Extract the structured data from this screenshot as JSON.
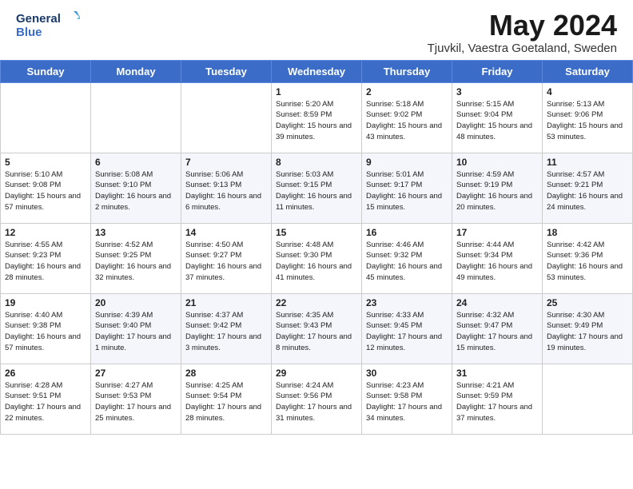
{
  "header": {
    "logo_line1": "General",
    "logo_line2": "Blue",
    "month_year": "May 2024",
    "location": "Tjuvkil, Vaestra Goetaland, Sweden"
  },
  "weekdays": [
    "Sunday",
    "Monday",
    "Tuesday",
    "Wednesday",
    "Thursday",
    "Friday",
    "Saturday"
  ],
  "weeks": [
    [
      {
        "day": "",
        "sunrise": "",
        "sunset": "",
        "daylight": ""
      },
      {
        "day": "",
        "sunrise": "",
        "sunset": "",
        "daylight": ""
      },
      {
        "day": "",
        "sunrise": "",
        "sunset": "",
        "daylight": ""
      },
      {
        "day": "1",
        "sunrise": "Sunrise: 5:20 AM",
        "sunset": "Sunset: 8:59 PM",
        "daylight": "Daylight: 15 hours and 39 minutes."
      },
      {
        "day": "2",
        "sunrise": "Sunrise: 5:18 AM",
        "sunset": "Sunset: 9:02 PM",
        "daylight": "Daylight: 15 hours and 43 minutes."
      },
      {
        "day": "3",
        "sunrise": "Sunrise: 5:15 AM",
        "sunset": "Sunset: 9:04 PM",
        "daylight": "Daylight: 15 hours and 48 minutes."
      },
      {
        "day": "4",
        "sunrise": "Sunrise: 5:13 AM",
        "sunset": "Sunset: 9:06 PM",
        "daylight": "Daylight: 15 hours and 53 minutes."
      }
    ],
    [
      {
        "day": "5",
        "sunrise": "Sunrise: 5:10 AM",
        "sunset": "Sunset: 9:08 PM",
        "daylight": "Daylight: 15 hours and 57 minutes."
      },
      {
        "day": "6",
        "sunrise": "Sunrise: 5:08 AM",
        "sunset": "Sunset: 9:10 PM",
        "daylight": "Daylight: 16 hours and 2 minutes."
      },
      {
        "day": "7",
        "sunrise": "Sunrise: 5:06 AM",
        "sunset": "Sunset: 9:13 PM",
        "daylight": "Daylight: 16 hours and 6 minutes."
      },
      {
        "day": "8",
        "sunrise": "Sunrise: 5:03 AM",
        "sunset": "Sunset: 9:15 PM",
        "daylight": "Daylight: 16 hours and 11 minutes."
      },
      {
        "day": "9",
        "sunrise": "Sunrise: 5:01 AM",
        "sunset": "Sunset: 9:17 PM",
        "daylight": "Daylight: 16 hours and 15 minutes."
      },
      {
        "day": "10",
        "sunrise": "Sunrise: 4:59 AM",
        "sunset": "Sunset: 9:19 PM",
        "daylight": "Daylight: 16 hours and 20 minutes."
      },
      {
        "day": "11",
        "sunrise": "Sunrise: 4:57 AM",
        "sunset": "Sunset: 9:21 PM",
        "daylight": "Daylight: 16 hours and 24 minutes."
      }
    ],
    [
      {
        "day": "12",
        "sunrise": "Sunrise: 4:55 AM",
        "sunset": "Sunset: 9:23 PM",
        "daylight": "Daylight: 16 hours and 28 minutes."
      },
      {
        "day": "13",
        "sunrise": "Sunrise: 4:52 AM",
        "sunset": "Sunset: 9:25 PM",
        "daylight": "Daylight: 16 hours and 32 minutes."
      },
      {
        "day": "14",
        "sunrise": "Sunrise: 4:50 AM",
        "sunset": "Sunset: 9:27 PM",
        "daylight": "Daylight: 16 hours and 37 minutes."
      },
      {
        "day": "15",
        "sunrise": "Sunrise: 4:48 AM",
        "sunset": "Sunset: 9:30 PM",
        "daylight": "Daylight: 16 hours and 41 minutes."
      },
      {
        "day": "16",
        "sunrise": "Sunrise: 4:46 AM",
        "sunset": "Sunset: 9:32 PM",
        "daylight": "Daylight: 16 hours and 45 minutes."
      },
      {
        "day": "17",
        "sunrise": "Sunrise: 4:44 AM",
        "sunset": "Sunset: 9:34 PM",
        "daylight": "Daylight: 16 hours and 49 minutes."
      },
      {
        "day": "18",
        "sunrise": "Sunrise: 4:42 AM",
        "sunset": "Sunset: 9:36 PM",
        "daylight": "Daylight: 16 hours and 53 minutes."
      }
    ],
    [
      {
        "day": "19",
        "sunrise": "Sunrise: 4:40 AM",
        "sunset": "Sunset: 9:38 PM",
        "daylight": "Daylight: 16 hours and 57 minutes."
      },
      {
        "day": "20",
        "sunrise": "Sunrise: 4:39 AM",
        "sunset": "Sunset: 9:40 PM",
        "daylight": "Daylight: 17 hours and 1 minute."
      },
      {
        "day": "21",
        "sunrise": "Sunrise: 4:37 AM",
        "sunset": "Sunset: 9:42 PM",
        "daylight": "Daylight: 17 hours and 3 minutes."
      },
      {
        "day": "22",
        "sunrise": "Sunrise: 4:35 AM",
        "sunset": "Sunset: 9:43 PM",
        "daylight": "Daylight: 17 hours and 8 minutes."
      },
      {
        "day": "23",
        "sunrise": "Sunrise: 4:33 AM",
        "sunset": "Sunset: 9:45 PM",
        "daylight": "Daylight: 17 hours and 12 minutes."
      },
      {
        "day": "24",
        "sunrise": "Sunrise: 4:32 AM",
        "sunset": "Sunset: 9:47 PM",
        "daylight": "Daylight: 17 hours and 15 minutes."
      },
      {
        "day": "25",
        "sunrise": "Sunrise: 4:30 AM",
        "sunset": "Sunset: 9:49 PM",
        "daylight": "Daylight: 17 hours and 19 minutes."
      }
    ],
    [
      {
        "day": "26",
        "sunrise": "Sunrise: 4:28 AM",
        "sunset": "Sunset: 9:51 PM",
        "daylight": "Daylight: 17 hours and 22 minutes."
      },
      {
        "day": "27",
        "sunrise": "Sunrise: 4:27 AM",
        "sunset": "Sunset: 9:53 PM",
        "daylight": "Daylight: 17 hours and 25 minutes."
      },
      {
        "day": "28",
        "sunrise": "Sunrise: 4:25 AM",
        "sunset": "Sunset: 9:54 PM",
        "daylight": "Daylight: 17 hours and 28 minutes."
      },
      {
        "day": "29",
        "sunrise": "Sunrise: 4:24 AM",
        "sunset": "Sunset: 9:56 PM",
        "daylight": "Daylight: 17 hours and 31 minutes."
      },
      {
        "day": "30",
        "sunrise": "Sunrise: 4:23 AM",
        "sunset": "Sunset: 9:58 PM",
        "daylight": "Daylight: 17 hours and 34 minutes."
      },
      {
        "day": "31",
        "sunrise": "Sunrise: 4:21 AM",
        "sunset": "Sunset: 9:59 PM",
        "daylight": "Daylight: 17 hours and 37 minutes."
      },
      {
        "day": "",
        "sunrise": "",
        "sunset": "",
        "daylight": ""
      }
    ]
  ]
}
